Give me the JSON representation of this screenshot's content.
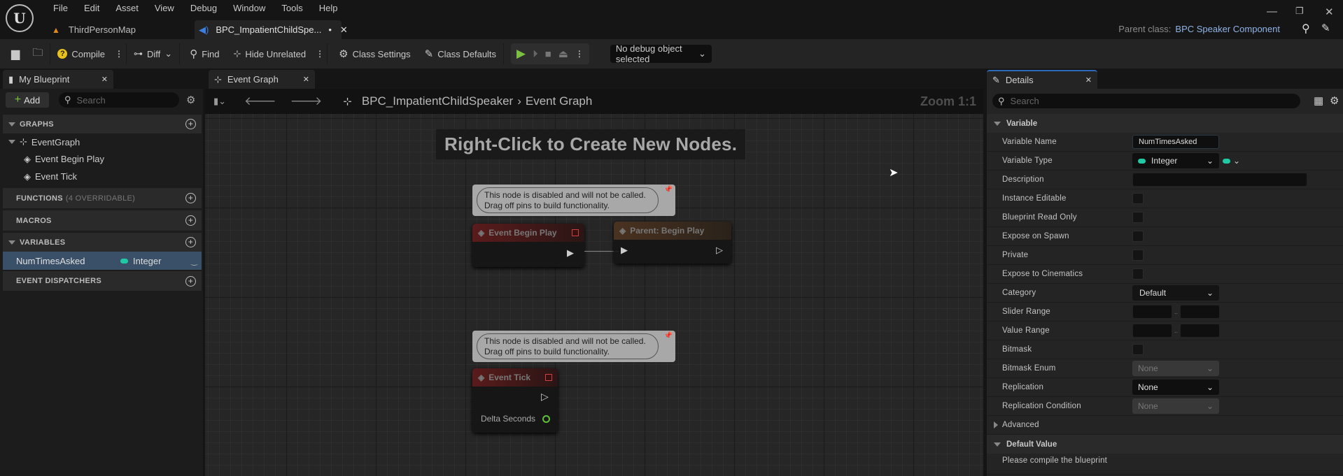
{
  "menu": {
    "items": [
      "File",
      "Edit",
      "Asset",
      "View",
      "Debug",
      "Window",
      "Tools",
      "Help"
    ]
  },
  "tabs": [
    {
      "label": "ThirdPersonMap",
      "icon": "level-icon"
    },
    {
      "label": "BPC_ImpatientChildSpe...",
      "modified": "•",
      "icon": "speaker-icon"
    }
  ],
  "parent_class": {
    "label": "Parent class:",
    "value": "BPC Speaker Component"
  },
  "toolbar": {
    "compile": "Compile",
    "diff": "Diff",
    "find": "Find",
    "hide_unrelated": "Hide Unrelated",
    "class_settings": "Class Settings",
    "class_defaults": "Class Defaults",
    "debug_object": "No debug object selected"
  },
  "my_blueprint": {
    "tab_label": "My Blueprint",
    "add_label": "Add",
    "search_placeholder": "Search",
    "sections": {
      "graphs": "GRAPHS",
      "functions": "FUNCTIONS",
      "functions_note": "(4 OVERRIDABLE)",
      "macros": "MACROS",
      "variables": "VARIABLES",
      "dispatchers": "EVENT DISPATCHERS"
    },
    "graph_tree": {
      "name": "EventGraph",
      "events": [
        "Event Begin Play",
        "Event Tick"
      ]
    },
    "variables": [
      {
        "name": "NumTimesAsked",
        "type": "Integer",
        "type_color": "#1fc9a3"
      }
    ]
  },
  "graph": {
    "tab_label": "Event Graph",
    "breadcrumb": [
      "BPC_ImpatientChildSpeaker",
      "Event Graph"
    ],
    "zoom": "Zoom 1:1",
    "hint": "Right-Click to Create New Nodes.",
    "comment_text": "This node is disabled and will not be called.\nDrag off pins to build functionality.",
    "nodes": {
      "begin_play": "Event Begin Play",
      "parent_begin_play": "Parent: Begin Play",
      "tick": "Event Tick",
      "delta_seconds": "Delta Seconds"
    }
  },
  "details": {
    "tab_label": "Details",
    "search_placeholder": "Search",
    "section_variable": "Variable",
    "rows": {
      "variable_name": {
        "label": "Variable Name",
        "value": "NumTimesAsked"
      },
      "variable_type": {
        "label": "Variable Type",
        "value": "Integer"
      },
      "description": {
        "label": "Description",
        "value": ""
      },
      "instance_editable": {
        "label": "Instance Editable",
        "checked": false
      },
      "blueprint_read_only": {
        "label": "Blueprint Read Only",
        "checked": false
      },
      "expose_on_spawn": {
        "label": "Expose on Spawn",
        "checked": false
      },
      "private": {
        "label": "Private",
        "checked": false
      },
      "expose_to_cinematics": {
        "label": "Expose to Cinematics",
        "checked": false
      },
      "category": {
        "label": "Category",
        "value": "Default"
      },
      "slider_range": {
        "label": "Slider Range",
        "sep": ".."
      },
      "value_range": {
        "label": "Value Range",
        "sep": ".."
      },
      "bitmask": {
        "label": "Bitmask",
        "checked": false
      },
      "bitmask_enum": {
        "label": "Bitmask Enum",
        "value": "None"
      },
      "replication": {
        "label": "Replication",
        "value": "None"
      },
      "replication_condition": {
        "label": "Replication Condition",
        "value": "None"
      }
    },
    "advanced": "Advanced",
    "section_default": "Default Value",
    "default_note": "Please compile the blueprint"
  }
}
